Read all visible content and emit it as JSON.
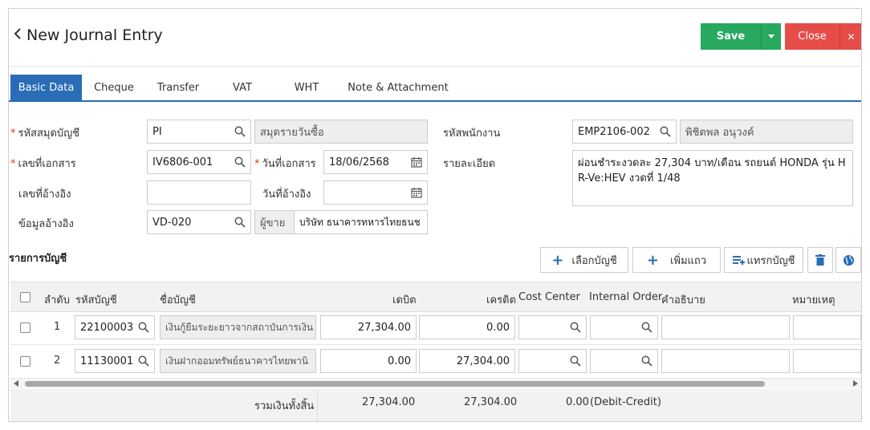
{
  "header": {
    "title": "New Journal Entry",
    "save": "Save",
    "close": "Close"
  },
  "tabs": [
    "Basic Data",
    "Cheque",
    "Transfer",
    "VAT",
    "WHT",
    "Note & Attachment"
  ],
  "form": {
    "book_code_label": "รหัสสมุดบัญชี",
    "book_code": "PI",
    "book_name": "สมุดรายวันซื้อ",
    "doc_no_label": "เลขที่เอกสาร",
    "doc_no": "IV6806-001",
    "doc_date_label": "วันที่เอกสาร",
    "doc_date": "18/06/2568",
    "ref_no_label": "เลขที่อ้างอิง",
    "ref_no": "",
    "ref_date_label": "วันที่อ้างอิง",
    "ref_date": "",
    "ref_data_label": "ข้อมูลอ้างอิง",
    "ref_data": "VD-020",
    "vendor_label": "ผู้ขาย",
    "vendor_name": "บริษัท ธนาคารทหารไทยธนช",
    "employee_label": "รหัสพนักงาน",
    "employee_code": "EMP2106-002",
    "employee_name": "พิชิตพล อนุวงค์",
    "detail_label": "รายละเอียด",
    "detail": "ผ่อนชำระงวดละ 27,304 บาท/เดือน รถยนต์ HONDA รุ่น HR-Ve:HEV งวดที่ 1/48"
  },
  "section": {
    "title": "รายการบัญชี",
    "select_account": "เลือกบัญชี",
    "add_row": "เพิ่มแถว",
    "insert_account": "แทรกบัญชี"
  },
  "table": {
    "headers": {
      "seq": "ลำดับ",
      "code": "รหัสบัญชี",
      "name": "ชื่อบัญชี",
      "debit": "เดบิต",
      "credit": "เครดิต",
      "cost_center": "Cost Center",
      "internal_order": "Internal Order",
      "description": "คำอธิบาย",
      "note": "หมายเหตุ"
    },
    "rows": [
      {
        "seq": "1",
        "code": "22100003",
        "name": "เงินกู้ยืมระยะยาวจากสถาบันการเงิน",
        "debit": "27,304.00",
        "credit": "0.00"
      },
      {
        "seq": "2",
        "code": "11130001",
        "name": "เงินฝากออมทรัพย์ธนาคารไทยพานิ",
        "debit": "0.00",
        "credit": "27,304.00"
      }
    ],
    "footer": {
      "label": "รวมเงินทั้งสิ้น",
      "debit_total": "27,304.00",
      "credit_total": "27,304.00",
      "diff": "0.00",
      "diff_label": "(Debit-Credit)"
    }
  },
  "colors": {
    "primary": "#2a6cb6",
    "save": "#27a960",
    "close": "#e64c48"
  }
}
